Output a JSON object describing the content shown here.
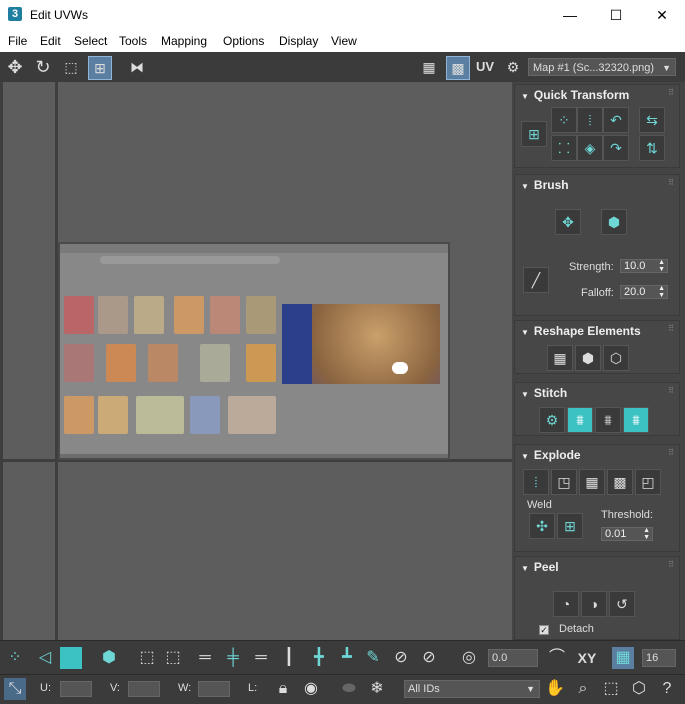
{
  "window": {
    "title": "Edit UVWs",
    "app_icon": "3",
    "min": "—",
    "max": "☐",
    "close": "✕"
  },
  "menu": [
    "File",
    "Edit",
    "Select",
    "Tools",
    "Mapping",
    "Options",
    "Display",
    "View"
  ],
  "toolbar": {
    "uv_label": "UV",
    "map_select": "Map #1 (Sc...32320.png)"
  },
  "panels": {
    "quick_transform": {
      "title": "Quick Transform"
    },
    "brush": {
      "title": "Brush",
      "strength_label": "Strength:",
      "strength_value": "10.0",
      "falloff_label": "Falloff:",
      "falloff_value": "20.0"
    },
    "reshape": {
      "title": "Reshape Elements"
    },
    "stitch": {
      "title": "Stitch"
    },
    "explode": {
      "title": "Explode",
      "weld_label": "Weld",
      "threshold_label": "Threshold:",
      "threshold_value": "0.01"
    },
    "peel": {
      "title": "Peel",
      "detach_label": "Detach"
    }
  },
  "bottom": {
    "angle_value": "0.0",
    "xy_label": "XY",
    "grid_value": "16",
    "u_label": "U:",
    "v_label": "V:",
    "w_label": "W:",
    "l_label": "L:",
    "ids_select": "All IDs"
  }
}
